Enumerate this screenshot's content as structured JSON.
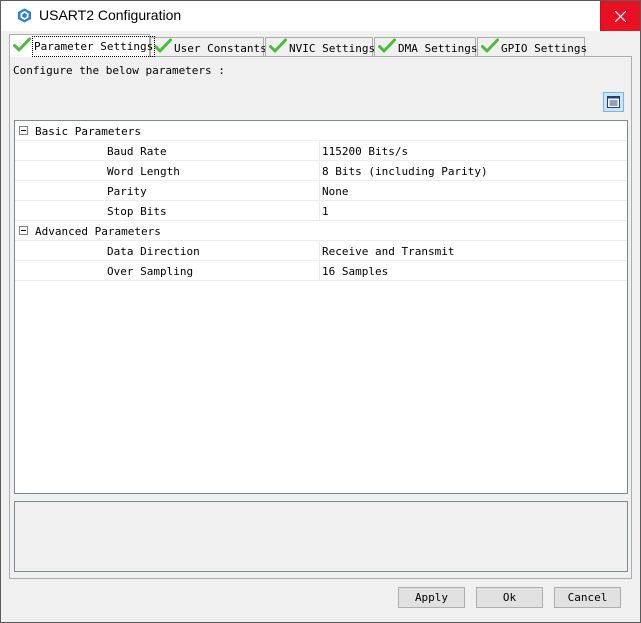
{
  "window": {
    "title": "USART2 Configuration"
  },
  "tabs": [
    {
      "label": "Parameter Settings",
      "icon": "green-check-icon",
      "active": true
    },
    {
      "label": "User Constants",
      "icon": "green-check-icon",
      "active": false
    },
    {
      "label": "NVIC Settings",
      "icon": "green-check-icon",
      "active": false
    },
    {
      "label": "DMA Settings",
      "icon": "green-check-icon",
      "active": false
    },
    {
      "label": "GPIO Settings",
      "icon": "green-check-icon",
      "active": false
    }
  ],
  "panel": {
    "intro": "Configure the below parameters :",
    "view_toggle_icon": "categorized-list-icon"
  },
  "groups": [
    {
      "name": "Basic Parameters",
      "expanded": true,
      "rows": [
        {
          "label": "Baud Rate",
          "value": "115200 Bits/s"
        },
        {
          "label": "Word Length",
          "value": "8 Bits (including Parity)"
        },
        {
          "label": "Parity",
          "value": "None"
        },
        {
          "label": "Stop Bits",
          "value": "1"
        }
      ]
    },
    {
      "name": "Advanced Parameters",
      "expanded": true,
      "rows": [
        {
          "label": "Data Direction",
          "value": "Receive and Transmit"
        },
        {
          "label": "Over Sampling",
          "value": "16 Samples"
        }
      ]
    }
  ],
  "buttons": {
    "apply": "Apply",
    "ok": "Ok",
    "cancel": "Cancel"
  },
  "colors": {
    "close_button": "#e81123",
    "check": "#4cba3c",
    "selected_button": "#cce4f7"
  }
}
